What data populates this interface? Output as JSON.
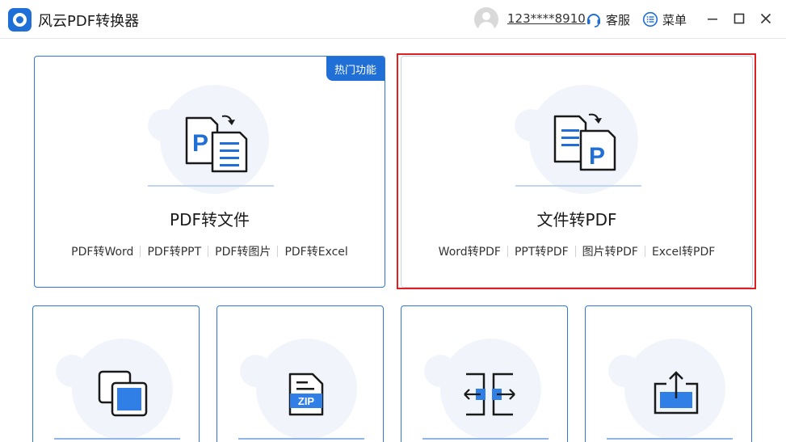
{
  "app": {
    "title": "风云PDF转换器",
    "account": "123****8910",
    "service_label": "客服",
    "menu_label": "菜单"
  },
  "colors": {
    "accent": "#1f6fd6",
    "selection": "#e02020"
  },
  "feature_cards": [
    {
      "title": "PDF转文件",
      "badge": "热门功能",
      "icon": "pdf-to-file-icon",
      "links": [
        "PDF转Word",
        "PDF转PPT",
        "PDF转图片",
        "PDF转Excel"
      ]
    },
    {
      "title": "文件转PDF",
      "icon": "file-to-pdf-icon",
      "links": [
        "Word转PDF",
        "PPT转PDF",
        "图片转PDF",
        "Excel转PDF"
      ],
      "selected": true
    }
  ],
  "tool_cards": [
    {
      "icon": "copy-pages-icon"
    },
    {
      "icon": "zip-compress-icon",
      "icon_text": "ZIP"
    },
    {
      "icon": "split-merge-icon"
    },
    {
      "icon": "export-share-icon"
    }
  ]
}
